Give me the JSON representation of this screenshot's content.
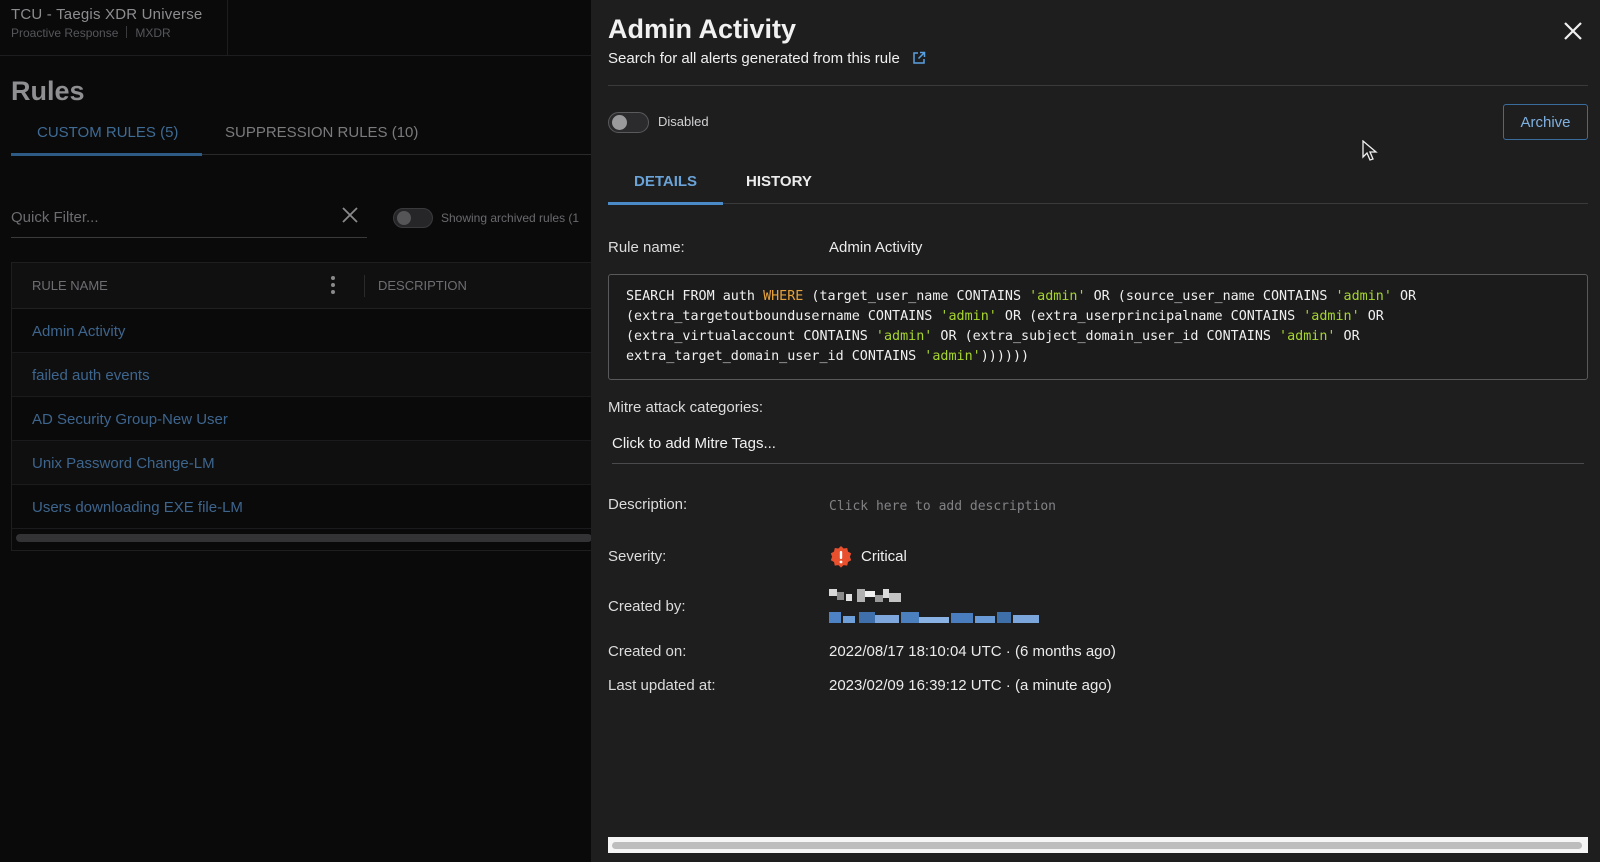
{
  "background": {
    "tenant_title": "TCU - Taegis XDR Universe",
    "tenant_sub_1": "Proactive Response",
    "tenant_sub_2": "MXDR",
    "page_title": "Rules",
    "tabs": [
      {
        "label": "CUSTOM RULES (5)",
        "active": true
      },
      {
        "label": "SUPPRESSION RULES (10)",
        "active": false
      }
    ],
    "quick_filter_placeholder": "Quick Filter...",
    "archived_label": "Showing archived rules (1",
    "table": {
      "columns": [
        "RULE NAME",
        "DESCRIPTION"
      ],
      "rows": [
        "Admin Activity",
        "failed auth events",
        "AD Security Group-New User",
        "Unix Password Change-LM",
        "Users downloading EXE file-LM"
      ]
    }
  },
  "drawer": {
    "title": "Admin Activity",
    "search_link": "Search for all alerts generated from this rule",
    "toggle_label": "Disabled",
    "toggle_on": false,
    "archive_label": "Archive",
    "tabs": [
      {
        "label": "DETAILS",
        "active": true
      },
      {
        "label": "HISTORY",
        "active": false
      }
    ],
    "fields": {
      "rule_name_label": "Rule name:",
      "rule_name_value": "Admin Activity",
      "mitre_label": "Mitre attack categories:",
      "mitre_placeholder": "Click to add Mitre Tags...",
      "description_label": "Description:",
      "description_placeholder": "Click here to add description",
      "severity_label": "Severity:",
      "severity_value": "Critical",
      "created_by_label": "Created by:",
      "created_on_label": "Created on:",
      "created_on_value": "2022/08/17 18:10:04 UTC · (6 months ago)",
      "updated_label": "Last updated at:",
      "updated_value": "2023/02/09 16:39:12 UTC · (a minute ago)"
    },
    "query": {
      "segments": [
        {
          "t": "SEARCH FROM auth ",
          "c": "plain"
        },
        {
          "t": "WHERE",
          "c": "kw"
        },
        {
          "t": " (target_user_name CONTAINS ",
          "c": "plain"
        },
        {
          "t": "'admin'",
          "c": "str"
        },
        {
          "t": " OR (source_user_name CONTAINS ",
          "c": "plain"
        },
        {
          "t": "'admin'",
          "c": "str"
        },
        {
          "t": " OR\n(extra_targetoutboundusername CONTAINS ",
          "c": "plain"
        },
        {
          "t": "'admin'",
          "c": "str"
        },
        {
          "t": " OR (extra_userprincipalname CONTAINS ",
          "c": "plain"
        },
        {
          "t": "'admin'",
          "c": "str"
        },
        {
          "t": " OR\n(extra_virtualaccount CONTAINS ",
          "c": "plain"
        },
        {
          "t": "'admin'",
          "c": "str"
        },
        {
          "t": " OR (extra_subject_domain_user_id CONTAINS ",
          "c": "plain"
        },
        {
          "t": "'admin'",
          "c": "str"
        },
        {
          "t": " OR\nextra_target_domain_user_id CONTAINS ",
          "c": "plain"
        },
        {
          "t": "'admin'",
          "c": "str"
        },
        {
          "t": "))))))",
          "c": "plain"
        }
      ]
    },
    "colors": {
      "accent": "#6aa3d8",
      "keyword": "#e6a23c",
      "string": "#a6d52f",
      "critical": "#e8502e"
    }
  }
}
